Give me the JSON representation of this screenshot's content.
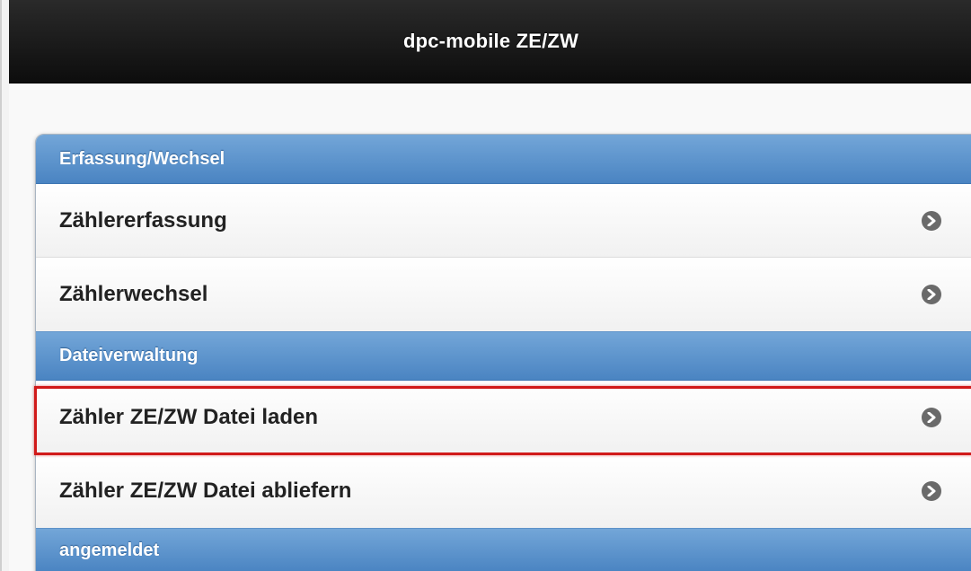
{
  "header": {
    "title": "dpc-mobile ZE/ZW"
  },
  "sections": [
    {
      "divider": "Erfassung/Wechsel",
      "items": [
        {
          "label": "Zählererfassung",
          "icon": "chevron-right-icon"
        },
        {
          "label": "Zählerwechsel",
          "icon": "chevron-right-icon"
        }
      ]
    },
    {
      "divider": "Dateiverwaltung",
      "items": [
        {
          "label": "Zähler ZE/ZW Datei laden",
          "icon": "chevron-right-icon",
          "highlighted": true
        },
        {
          "label": "Zähler ZE/ZW Datei abliefern",
          "icon": "chevron-right-icon"
        }
      ]
    },
    {
      "divider": "angemeldet",
      "items": []
    }
  ],
  "colors": {
    "header_bg": "#111111",
    "divider_bg": "#5a92cc",
    "highlight_border": "#d11a1a",
    "chevron_bg": "#6a6a6a"
  }
}
